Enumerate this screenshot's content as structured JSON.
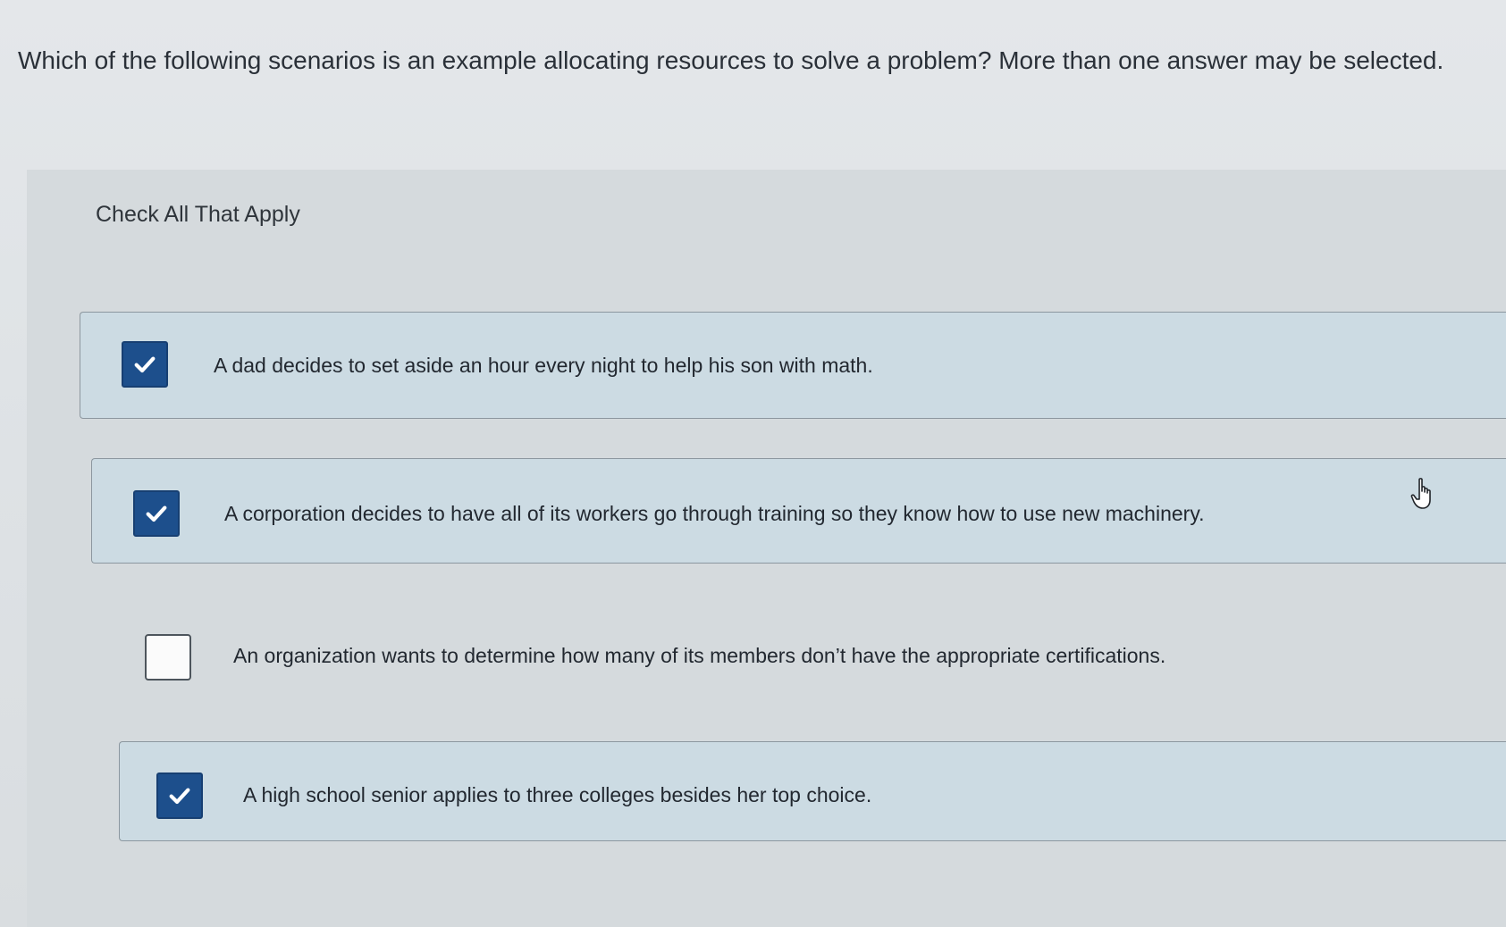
{
  "question": {
    "text": "Which of the following scenarios is an example allocating resources to solve a problem? More than one answer may be selected."
  },
  "instruction": {
    "text": "Check All That Apply"
  },
  "options": [
    {
      "label": "A dad decides to set aside an hour every night to help his son with math.",
      "checked": true
    },
    {
      "label": "A corporation decides to have all of its workers go through training so they know how to use new machinery.",
      "checked": true
    },
    {
      "label": "An organization wants to determine how many of its members don’t have the appropriate certifications.",
      "checked": false
    },
    {
      "label": "A high school senior applies to three colleges besides her top choice.",
      "checked": true
    }
  ],
  "icons": {
    "checkmark": "checkmark-icon",
    "cursor": "hand-pointer-icon"
  },
  "colors": {
    "checkbox_checked": "#1d4f8c",
    "selected_row_bg": "#ccdbe3"
  }
}
